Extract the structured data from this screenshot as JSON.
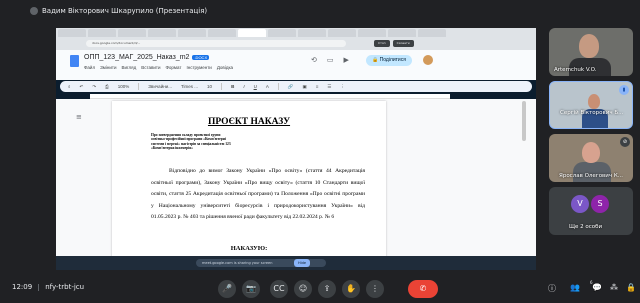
{
  "meet": {
    "presenter_label": "Вадим Вікторович Шкарупило (Презентація)",
    "meeting_time": "12:09",
    "meeting_code": "nfy-trbt-jcu"
  },
  "browser": {
    "tabs": [
      "",
      "",
      "",
      "",
      "",
      "",
      "",
      "",
      "",
      "",
      "",
      "",
      ""
    ],
    "url": "docs.google.com/document/d/...",
    "share_notice_buttons": [
      "Стоп",
      "Сховати"
    ]
  },
  "docs": {
    "filename": "ОПП_123_МАГ_2025_Наказ_m2",
    "file_badge": ".DOCX",
    "menu": [
      "Файл",
      "Змінити",
      "Вигляд",
      "Вставити",
      "Формат",
      "Інструменти",
      "Довідка"
    ],
    "share_button": "Поділитися",
    "toolbar": {
      "zoom": "100%",
      "style": "Звичайни...",
      "font": "Times ...",
      "font_size": "10",
      "bold": "B",
      "italic": "I",
      "underline": "U",
      "color": "A"
    }
  },
  "document": {
    "title": "ПРОЄКТ НАКАЗУ",
    "about": "Про затвердження складу проектної групи освітньо-професійної програми «Комп'ютерні системи і мережі» магістрів за спеціальністю 123 «Комп'ютерна інженерія»",
    "body": "Відповідно до вимог Закону України «Про освіту» (стаття 44 Акредитація освітньої програми), Закону України «Про вищу освіту» (стаття 10 Стандарти вищої освіти, стаття 25 Акредитація освітньої програми) та Положення «Про освітні програми у Національному університеті біоресурсів і природокористування України» від 01.05.2023 р. № 403 та рішення вченої ради факультету від 22.02.2024 р. № 6",
    "heading2": "НАКАЗУЮ:"
  },
  "taskbar": {
    "search_placeholder": "meet.google.com is sharing your screen",
    "share_hide_button": "Hide"
  },
  "participants": [
    {
      "name": "Artemchuk V.O."
    },
    {
      "name": "Сергій Вікторович Б..."
    },
    {
      "name": "Ярослав Олегович К..."
    },
    {
      "initials_a": "V",
      "initials_b": "S",
      "name": "Ще 2 особи"
    }
  ],
  "controls": {
    "mic": "🎤",
    "camera": "📷",
    "captions": "CC",
    "emoji": "☺",
    "present": "⇪",
    "raise_hand": "✋",
    "more": "⋮",
    "end": "✆",
    "info": "ⓘ",
    "people": "👥",
    "chat": "💬",
    "activities": "⁂",
    "lock": "🔒",
    "people_count": "6"
  }
}
